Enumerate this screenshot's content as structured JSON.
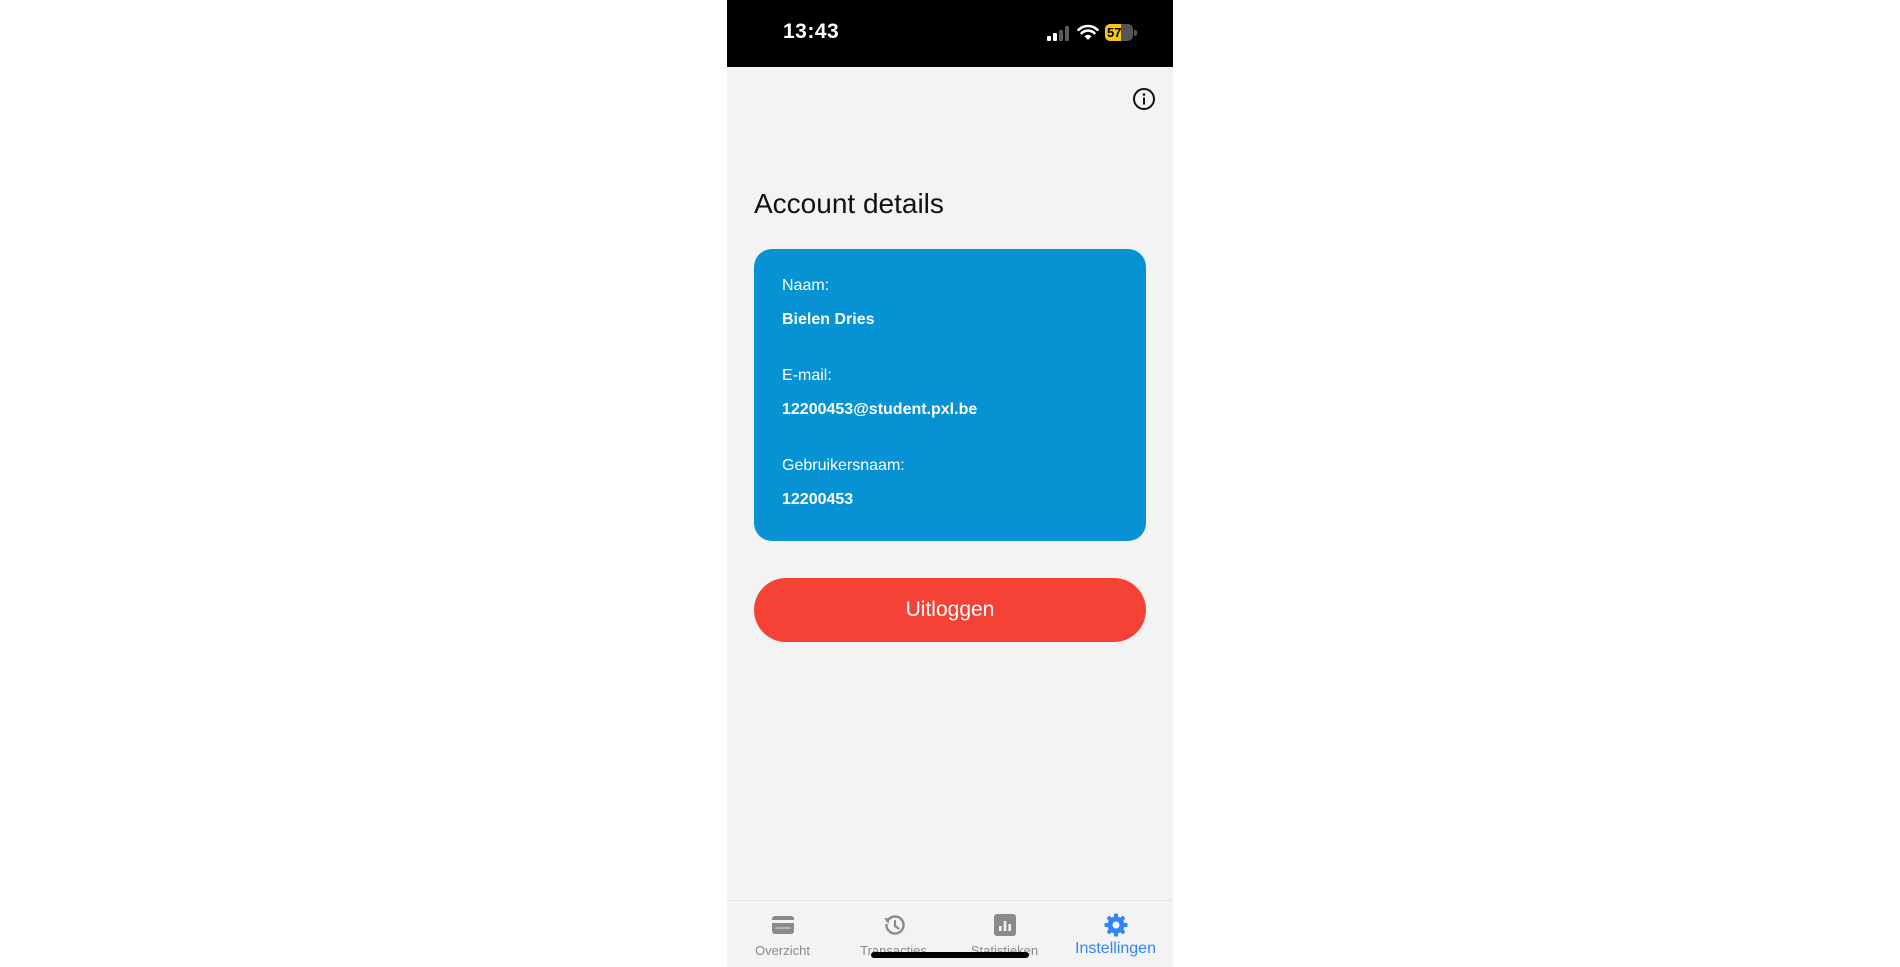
{
  "status_bar": {
    "time": "13:43",
    "battery_text": "57",
    "battery_level": 0.57,
    "battery_color": "#f5c518"
  },
  "header": {
    "info_icon": "info-circle-icon"
  },
  "main": {
    "title": "Account details",
    "card_color": "#0793d3",
    "fields": [
      {
        "label": "Naam:",
        "value": "Bielen Dries"
      },
      {
        "label": "E-mail:",
        "value": "12200453@student.pxl.be"
      },
      {
        "label": "Gebruikersnaam:",
        "value": "12200453"
      }
    ],
    "logout_label": "Uitloggen",
    "logout_color": "#f44336"
  },
  "tab_bar": {
    "active_color": "#2f86f6",
    "inactive_color": "#8a8a8a",
    "tabs": [
      {
        "label": "Overzicht",
        "icon": "wallet-icon",
        "active": false
      },
      {
        "label": "Transacties",
        "icon": "history-icon",
        "active": false
      },
      {
        "label": "Statistieken",
        "icon": "bar-chart-icon",
        "active": false
      },
      {
        "label": "Instellingen",
        "icon": "gear-icon",
        "active": true
      }
    ]
  }
}
